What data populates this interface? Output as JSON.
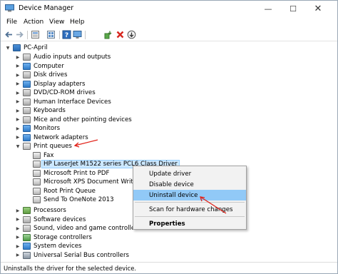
{
  "window": {
    "title": "Device Manager",
    "minimize_glyph": "—",
    "maximize_glyph": "☐",
    "close_glyph": "✕"
  },
  "menu": [
    "File",
    "Action",
    "View",
    "Help"
  ],
  "toolbar_icons": [
    "back-arrow-icon",
    "forward-arrow-icon",
    "properties-icon",
    "view-icon",
    "help-icon",
    "monitor-icon",
    "scan-hardware-icon",
    "uninstall-x-icon",
    "update-driver-icon"
  ],
  "tree": {
    "root": "PC-April",
    "categories": [
      "Audio inputs and outputs",
      "Computer",
      "Disk drives",
      "Display adapters",
      "DVD/CD-ROM drives",
      "Human Interface Devices",
      "Keyboards",
      "Mice and other pointing devices",
      "Monitors",
      "Network adapters",
      "Print queues"
    ],
    "print_queue_children": [
      "Fax",
      "HP LaserJet M1522 series PCL6 Class Driver",
      "Microsoft Print to PDF",
      "Microsoft XPS Document Writer",
      "Root Print Queue",
      "Send To OneNote 2013"
    ],
    "categories_after": [
      "Processors",
      "Software devices",
      "Sound, video and game controllers",
      "Storage controllers",
      "System devices",
      "Universal Serial Bus controllers"
    ]
  },
  "context_menu": {
    "update_driver": "Update driver",
    "disable_device": "Disable device",
    "uninstall_device": "Uninstall device",
    "scan_hardware": "Scan for hardware changes",
    "properties": "Properties"
  },
  "status": "Uninstalls the driver for the selected device.",
  "colors": {
    "selection": "#cce8ff",
    "menu_highlight": "#91c9f7",
    "annotation_arrow": "#e2231a"
  }
}
